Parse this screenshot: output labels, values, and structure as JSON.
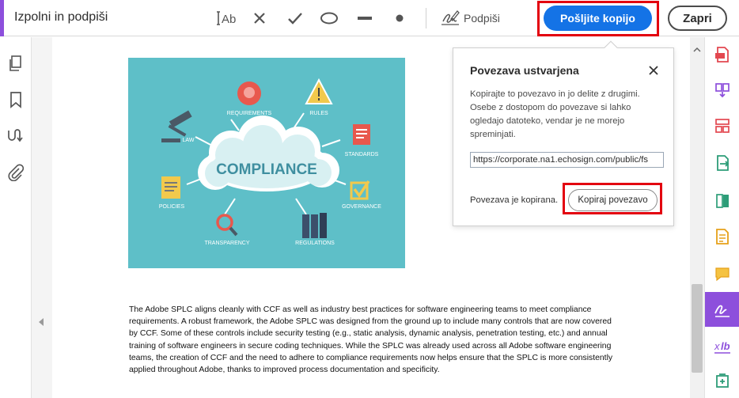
{
  "toolbar": {
    "title": "Izpolni in podpiši",
    "tools": [
      {
        "name": "text-tool",
        "label": "IAb"
      },
      {
        "name": "cross-tool",
        "label": "✕"
      },
      {
        "name": "check-tool",
        "label": "✓"
      },
      {
        "name": "circle-tool",
        "label": "○"
      },
      {
        "name": "line-tool",
        "label": "—"
      },
      {
        "name": "dot-tool",
        "label": "•"
      }
    ],
    "sign_label": "Podpiši",
    "send_label": "Pošljite kopijo",
    "close_label": "Zapri",
    "accent_color": "#8d4fdc",
    "primary_color": "#1473e6",
    "highlight_color": "#e3000f"
  },
  "left_rail": {
    "icons": [
      "pages-icon",
      "bookmark-icon",
      "signature-panel-icon",
      "attachment-icon"
    ]
  },
  "document": {
    "image": {
      "center_label": "COMPLIANCE",
      "labels": [
        "REQUIREMENTS",
        "RULES",
        "LAW",
        "STANDARDS",
        "POLICIES",
        "GOVERNANCE",
        "TRANSPARENCY",
        "REGULATIONS"
      ],
      "background_color": "#5ebfc8"
    },
    "paragraph": "The Adobe SPLC aligns cleanly with CCF as well as industry best practices for software engineering teams to meet compliance requirements. A robust framework, the Adobe SPLC was designed from the ground up to include many controls that are now covered by CCF. Some of these controls include security testing (e.g., static analysis, dynamic analysis, penetration testing, etc.) and annual training of software engineers in secure coding techniques. While the SPLC was already used across all Adobe software engineering teams, the creation of CCF and the need to adhere to compliance requirements now helps ensure that the SPLC is more consistently applied throughout Adobe, thanks to improved process documentation and specificity."
  },
  "popover": {
    "title": "Povezava ustvarjena",
    "description": "Kopirajte to povezavo in jo delite z drugimi. Osebe z dostopom do povezave si lahko ogledajo datoteko, vendar je ne morejo spreminjati.",
    "link_value": "https://corporate.na1.echosign.com/public/fs",
    "status": "Povezava je kopirana.",
    "copy_label": "Kopiraj povezavo"
  },
  "right_rail": {
    "icons": [
      "create-pdf-icon",
      "combine-files-icon",
      "organize-pages-icon",
      "export-pdf-icon",
      "compare-icon",
      "edit-pdf-icon",
      "comment-icon",
      "fill-sign-icon",
      "redact-icon",
      "more-tools-icon"
    ],
    "active": "fill-sign-icon"
  }
}
